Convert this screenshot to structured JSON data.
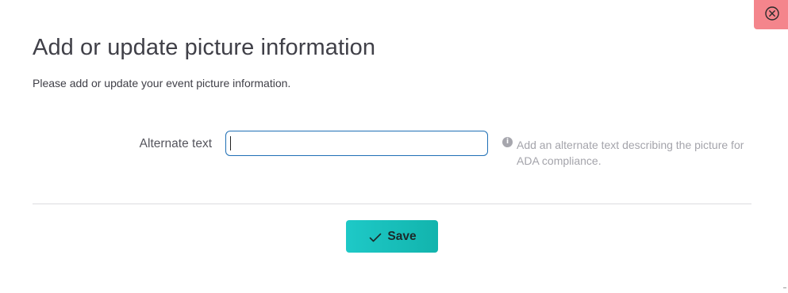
{
  "dialog": {
    "title": "Add or update picture information",
    "subtitle": "Please add or update your event picture information."
  },
  "form": {
    "alt_text": {
      "label": "Alternate text",
      "value": "",
      "placeholder": "",
      "help": "Add an alternate text describing the picture for ADA compliance."
    }
  },
  "actions": {
    "save_label": "Save"
  },
  "icons": {
    "close": "close-circle-icon",
    "info": "info-icon",
    "save": "checkmark-icon"
  },
  "colors": {
    "close_bg": "#f4858c",
    "accent": "#1ec9c7",
    "input_border": "#1f6fb5"
  }
}
